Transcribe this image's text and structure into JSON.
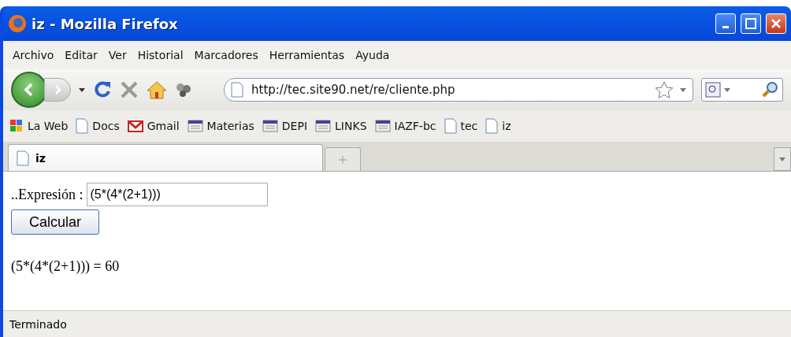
{
  "window": {
    "title": "iz - Mozilla Firefox"
  },
  "menu": [
    "Archivo",
    "Editar",
    "Ver",
    "Historial",
    "Marcadores",
    "Herramientas",
    "Ayuda"
  ],
  "address": {
    "value": "http://tec.site90.net/re/cliente.php"
  },
  "bookmarks": [
    {
      "label": "La Web",
      "kind": "google"
    },
    {
      "label": "Docs",
      "kind": "page"
    },
    {
      "label": "Gmail",
      "kind": "mail"
    },
    {
      "label": "Materias",
      "kind": "feed"
    },
    {
      "label": "DEPI",
      "kind": "feed"
    },
    {
      "label": "LINKS",
      "kind": "feed"
    },
    {
      "label": "IAZF-bc",
      "kind": "feed"
    },
    {
      "label": "tec",
      "kind": "page"
    },
    {
      "label": "iz",
      "kind": "page"
    }
  ],
  "tabs": [
    {
      "label": "iz",
      "selected": true
    }
  ],
  "form": {
    "label": "..Expresión :",
    "value": "(5*(4*(2+1)))",
    "button": "Calcular"
  },
  "result": "(5*(4*(2+1))) = 60",
  "status_bar": "Terminado"
}
